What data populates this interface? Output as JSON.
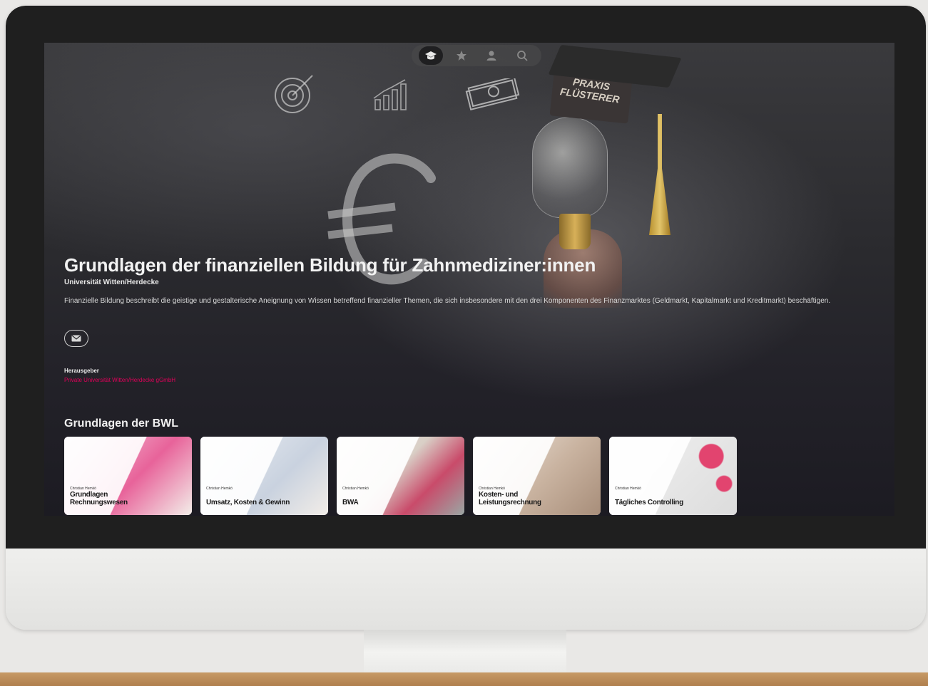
{
  "nav": {
    "items": [
      {
        "icon": "graduation-cap-icon",
        "active": true
      },
      {
        "icon": "star-icon",
        "active": false
      },
      {
        "icon": "user-icon",
        "active": false
      },
      {
        "icon": "search-icon",
        "active": false
      }
    ]
  },
  "hero": {
    "badge_text": "PRAXIS FLÜSTERER",
    "title": "Grundlagen der finanziellen Bildung für Zahnmediziner:innen",
    "subtitle": "Universität Witten/Herdecke",
    "description": "Finanzielle Bildung beschreibt die geistige und gestalterische Aneignung von Wissen betreffend finanzieller Themen, die sich insbesondere mit den drei Komponenten des Finanzmarktes (Geldmarkt, Kapitalmarkt und Kreditmarkt) beschäftigen.",
    "contact_icon": "mail-icon",
    "publisher_label": "Herausgeber",
    "publisher_value": "Private Universität Witten/Herdecke gGmbH"
  },
  "section": {
    "title": "Grundlagen der BWL",
    "courses": [
      {
        "author": "Christian Hemkö",
        "title": "Grundlagen Rechnungswesen",
        "accent": "#e8639a"
      },
      {
        "author": "Christian Hemkö",
        "title": "Umsatz, Kosten & Gewinn",
        "accent": "#b9c4d6"
      },
      {
        "author": "Christian Hemkö",
        "title": "BWA",
        "accent": "#c94b6a"
      },
      {
        "author": "Christian Hemkö",
        "title": "Kosten- und Leistungsrechnung",
        "accent": "#b89b80"
      },
      {
        "author": "Christian Hemkö",
        "title": "Tägliches Controlling",
        "accent": "#e2446f"
      }
    ]
  },
  "colors": {
    "accent": "#e2005a",
    "screen_bg": "#2a2a2e"
  }
}
